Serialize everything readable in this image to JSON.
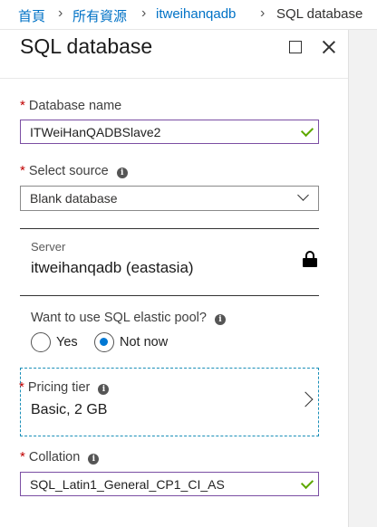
{
  "breadcrumb": {
    "items": [
      "首頁",
      "所有資源",
      "itweihanqadb",
      "SQL database"
    ]
  },
  "blade": {
    "title": "SQL database"
  },
  "form": {
    "database_name": {
      "label": "Database name",
      "value": "ITWeiHanQADBSlave2",
      "required": true,
      "valid": true
    },
    "select_source": {
      "label": "Select source",
      "value": "Blank database",
      "required": true
    },
    "server": {
      "label": "Server",
      "value": "itweihanqadb (eastasia)",
      "locked": true
    },
    "elastic_pool": {
      "question": "Want to use SQL elastic pool?",
      "options": [
        "Yes",
        "Not now"
      ],
      "selected": "Not now"
    },
    "pricing_tier": {
      "label": "Pricing tier",
      "value": "Basic, 2 GB",
      "required": true
    },
    "collation": {
      "label": "Collation",
      "value": "SQL_Latin1_General_CP1_CI_AS",
      "required": true,
      "valid": true
    }
  },
  "colors": {
    "link": "#0072c6",
    "required": "#c00000",
    "valid": "#5ea800",
    "focus_border": "#7b4ea3",
    "selection_dashed": "#1a8fb8",
    "radio_selected": "#0078d4"
  },
  "icons": {
    "breadcrumb_separator": "chevron-right-icon",
    "maximize": "maximize-icon",
    "close": "close-icon",
    "info": "info-icon",
    "valid": "checkmark-icon",
    "dropdown": "chevron-down-icon",
    "server_lock": "lock-icon",
    "pricing_tier": "chevron-right-icon"
  }
}
